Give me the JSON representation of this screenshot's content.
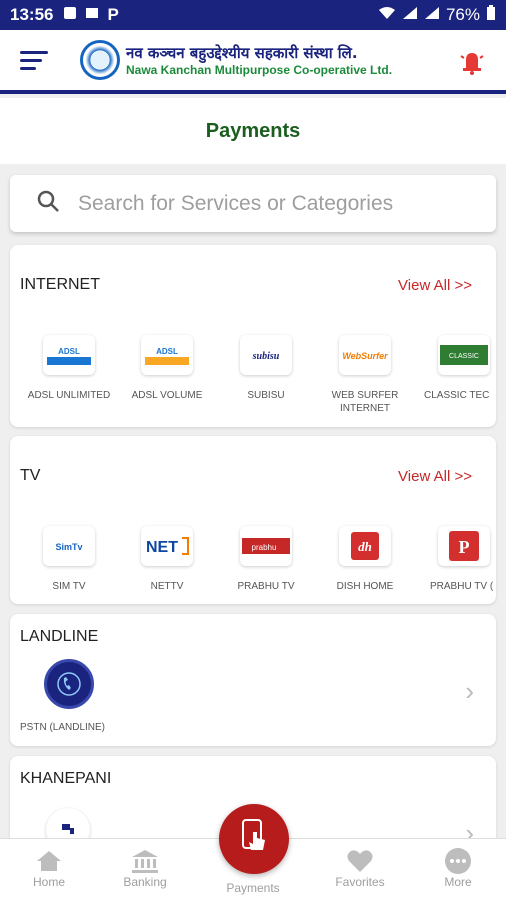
{
  "status": {
    "time": "13:56",
    "battery": "76%"
  },
  "brand": {
    "name_np": "नव कञ्चन बहुउद्देश्यीय सहकारी संस्था लि.",
    "name_en": "Nawa Kanchan Multipurpose Co-operative Ltd."
  },
  "page": {
    "title": "Payments"
  },
  "search": {
    "placeholder": "Search for Services or Categories"
  },
  "internet": {
    "title": "INTERNET",
    "view_all": "View All >>",
    "items": [
      {
        "label": "ADSL UNLIMITED",
        "logo": "ADSL"
      },
      {
        "label": "ADSL VOLUME",
        "logo": "ADSL"
      },
      {
        "label": "SUBISU",
        "logo": "subisu"
      },
      {
        "label": "WEB SURFER INTERNET",
        "logo": "WebSurfer"
      },
      {
        "label": "CLASSIC TEC",
        "logo": "CLASSIC"
      }
    ]
  },
  "tv": {
    "title": "TV",
    "view_all": "View All >>",
    "items": [
      {
        "label": "SIM TV",
        "logo": "SimTv"
      },
      {
        "label": "NETTV",
        "logo": "NET"
      },
      {
        "label": "PRABHU TV",
        "logo": "prabhu"
      },
      {
        "label": "DISH HOME",
        "logo": "dh"
      },
      {
        "label": "PRABHU TV (",
        "logo": "P"
      }
    ]
  },
  "landline": {
    "title": "LANDLINE",
    "items": [
      {
        "label": "PSTN (LANDLINE)"
      }
    ]
  },
  "khanepani": {
    "title": "KHANEPANI"
  },
  "nav": {
    "home": "Home",
    "banking": "Banking",
    "payments": "Payments",
    "favorites": "Favorites",
    "more": "More"
  },
  "colors": {
    "primary": "#1a237e",
    "accent": "#c62828",
    "title_green": "#1b5e20"
  }
}
